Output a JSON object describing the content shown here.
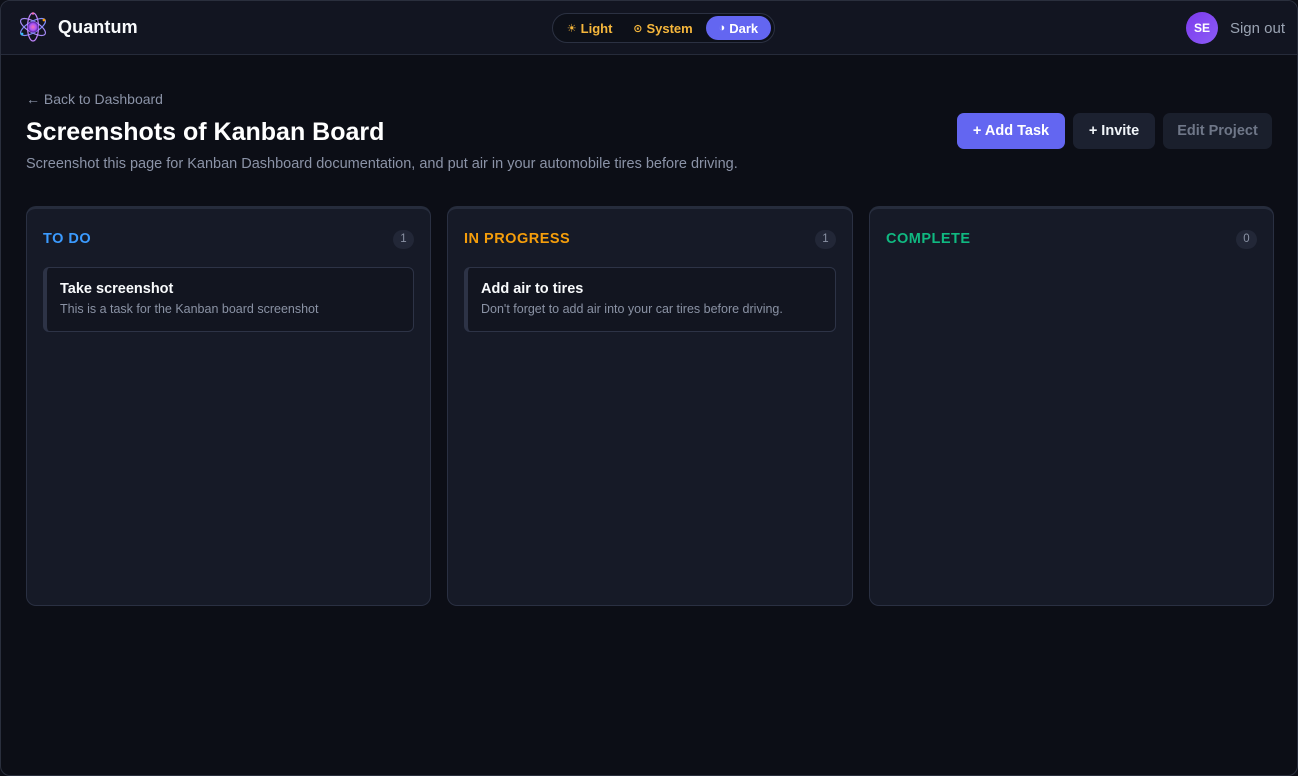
{
  "app": {
    "name": "Quantum"
  },
  "theme_toggle": {
    "options": [
      {
        "glyph": "☀",
        "label": "Light"
      },
      {
        "glyph": "⊙",
        "label": "System"
      },
      {
        "glyph": "◑",
        "label": "Dark"
      }
    ],
    "selected": "Dark"
  },
  "user": {
    "initials": "SE",
    "signout_label": "Sign out"
  },
  "page": {
    "back_label": "← Back to Dashboard",
    "title": "Screenshots of Kanban Board",
    "subtitle": "Screenshot this page for Kanban Dashboard documentation, and put air in your automobile tires before driving."
  },
  "actions": {
    "add_task": "+ Add Task",
    "invite": "+ Invite",
    "edit_project": "Edit Project"
  },
  "columns": [
    {
      "title": "TO DO",
      "count": "1",
      "color": "#3b9bff",
      "cards": [
        {
          "title": "Take screenshot",
          "description": "This is a task for the Kanban board screenshot"
        }
      ]
    },
    {
      "title": "IN PROGRESS",
      "count": "1",
      "color": "#f59e0b",
      "cards": [
        {
          "title": "Add air to tires",
          "description": "Don't forget to add air into your car tires before driving."
        }
      ]
    },
    {
      "title": "COMPLETE",
      "count": "0",
      "color": "#10b981",
      "cards": []
    }
  ],
  "colors": {
    "accent": "#6366f1",
    "theme_text": "#f6b73c",
    "background": "#0c0e16"
  },
  "icons": {
    "brand": "atom-logo-icon"
  }
}
